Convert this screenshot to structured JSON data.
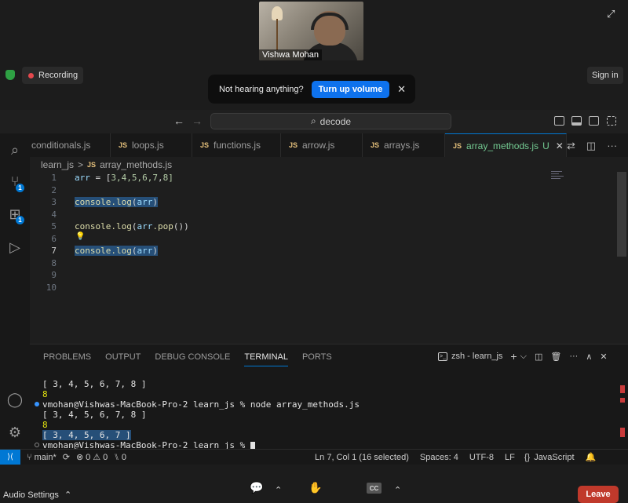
{
  "zoom": {
    "participant_name": "Vishwa Mohan",
    "recording_label": "Recording",
    "signin_label": "Sign in",
    "toast_text": "Not hearing anything?",
    "toast_button": "Turn up volume",
    "toast_close": "✕",
    "audio_settings_label": "Audio Settings",
    "leave_label": "Leave",
    "cc_label": "CC",
    "expand_glyph": "⤢",
    "colors": {
      "leave": "#c0392b",
      "toast_button": "#0e72ed",
      "recording_dot": "#e5484d"
    }
  },
  "vscode": {
    "command_center": "decode",
    "tabs": [
      {
        "label": "conditionals.js",
        "js": false
      },
      {
        "label": "loops.js",
        "js": true
      },
      {
        "label": "functions.js",
        "js": true
      },
      {
        "label": "arrow.js",
        "js": true
      },
      {
        "label": "arrays.js",
        "js": true
      },
      {
        "label": "array_methods.js",
        "js": true,
        "active": true,
        "status": "U"
      }
    ],
    "js_badge": "JS",
    "breadcrumb": {
      "folder": "learn_js",
      "sep": ">",
      "file": "array_methods.js"
    },
    "badges": {
      "scm": "1",
      "extensions": "1"
    },
    "editor": {
      "line_numbers": [
        "1",
        "2",
        "3",
        "4",
        "5",
        "6",
        "7",
        "8",
        "9",
        "10"
      ],
      "line1": {
        "var": "arr",
        "op": " = [",
        "nums": "3,4,5,6,7",
        "tail": "8]"
      },
      "line3": {
        "fn": "console.log",
        "open": "(",
        "var": "arr",
        "close": ")"
      },
      "line5": {
        "fn": "console.log",
        "open": "(",
        "var": "arr",
        "mid": ".pop",
        "close": "())"
      },
      "line7": {
        "fn": "console.log",
        "open": "(",
        "var": "arr",
        "close": ")"
      }
    },
    "panel": {
      "tabs": [
        "PROBLEMS",
        "OUTPUT",
        "DEBUG CONSOLE",
        "TERMINAL",
        "PORTS"
      ],
      "active_tab": "TERMINAL",
      "terminal_name": "zsh - learn_js",
      "plus": "+",
      "chevron": "⌵",
      "more": "···",
      "up": "∧",
      "close": "✕"
    },
    "terminal": [
      "[ 3, 4, 5, 6, 7, 8 ]",
      "8",
      "vmohan@Vishwas-MacBook-Pro-2 learn_js % node array_methods.js",
      "[ 3, 4, 5, 6, 7, 8 ]",
      "8",
      "[ 3, 4, 5, 6, 7 ]",
      "vmohan@Vishwas-MacBook-Pro-2 learn_js % "
    ],
    "status": {
      "branch": "main*",
      "errors": "0",
      "warnings": "0",
      "ports": "0",
      "position": "Ln 7, Col 1 (16 selected)",
      "spaces": "Spaces: 4",
      "encoding": "UTF-8",
      "eol": "LF",
      "language": "JavaScript"
    }
  }
}
